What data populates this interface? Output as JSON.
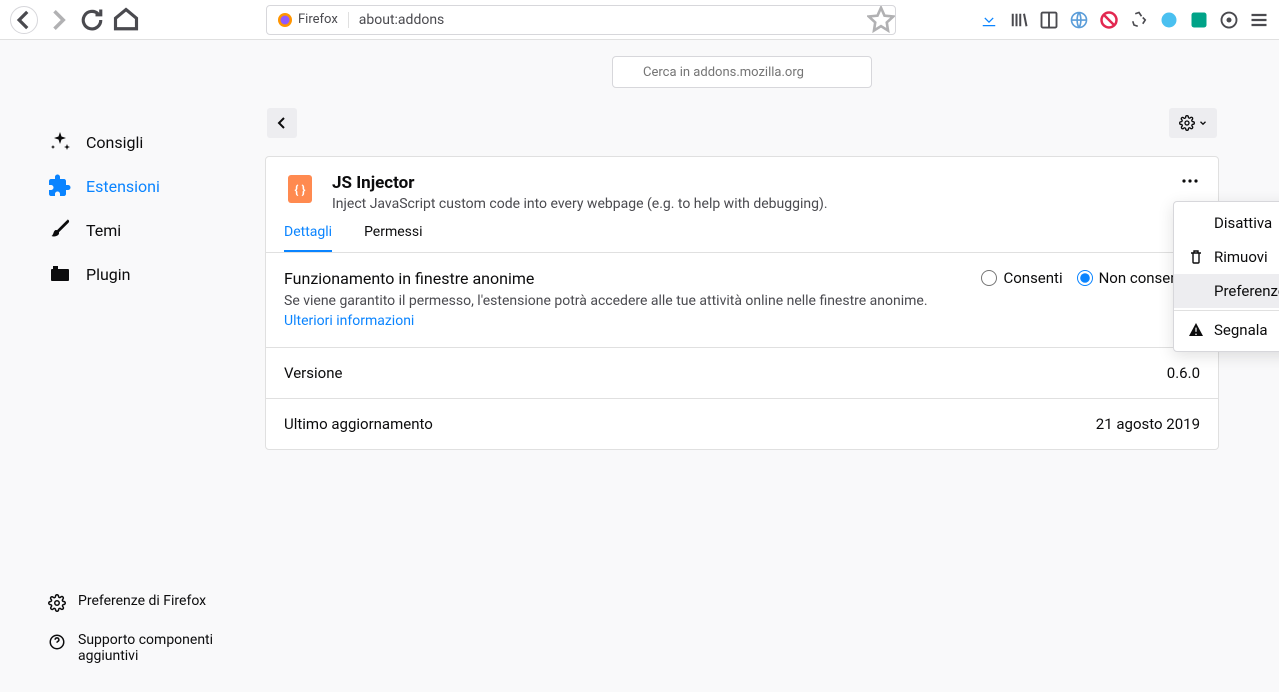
{
  "browser": {
    "identity_text": "Firefox",
    "url": "about:addons",
    "search_placeholder": "Cerca in addons.mozilla.org"
  },
  "sidebar": {
    "items": [
      {
        "label": "Consigli"
      },
      {
        "label": "Estensioni"
      },
      {
        "label": "Temi"
      },
      {
        "label": "Plugin"
      }
    ],
    "bottom": {
      "prefs": "Preferenze di Firefox",
      "support": "Supporto componenti aggiuntivi"
    }
  },
  "extension": {
    "name": "JS Injector",
    "description": "Inject JavaScript custom code into every webpage (e.g. to help with debugging).",
    "tabs": {
      "details": "Dettagli",
      "permissions": "Permessi"
    },
    "private": {
      "title": "Funzionamento in finestre anonime",
      "description": "Se viene garantito il permesso, l'estensione potrà accedere alle tue attività online nelle finestre anonime. ",
      "more_link": "Ulteriori informazioni",
      "allow": "Consenti",
      "deny": "Non consentire"
    },
    "version_label": "Versione",
    "version_value": "0.6.0",
    "updated_label": "Ultimo aggiornamento",
    "updated_value": "21 agosto 2019"
  },
  "dropdown": {
    "disable": "Disattiva",
    "remove": "Rimuovi",
    "preferences": "Preferenze",
    "report": "Segnala"
  }
}
